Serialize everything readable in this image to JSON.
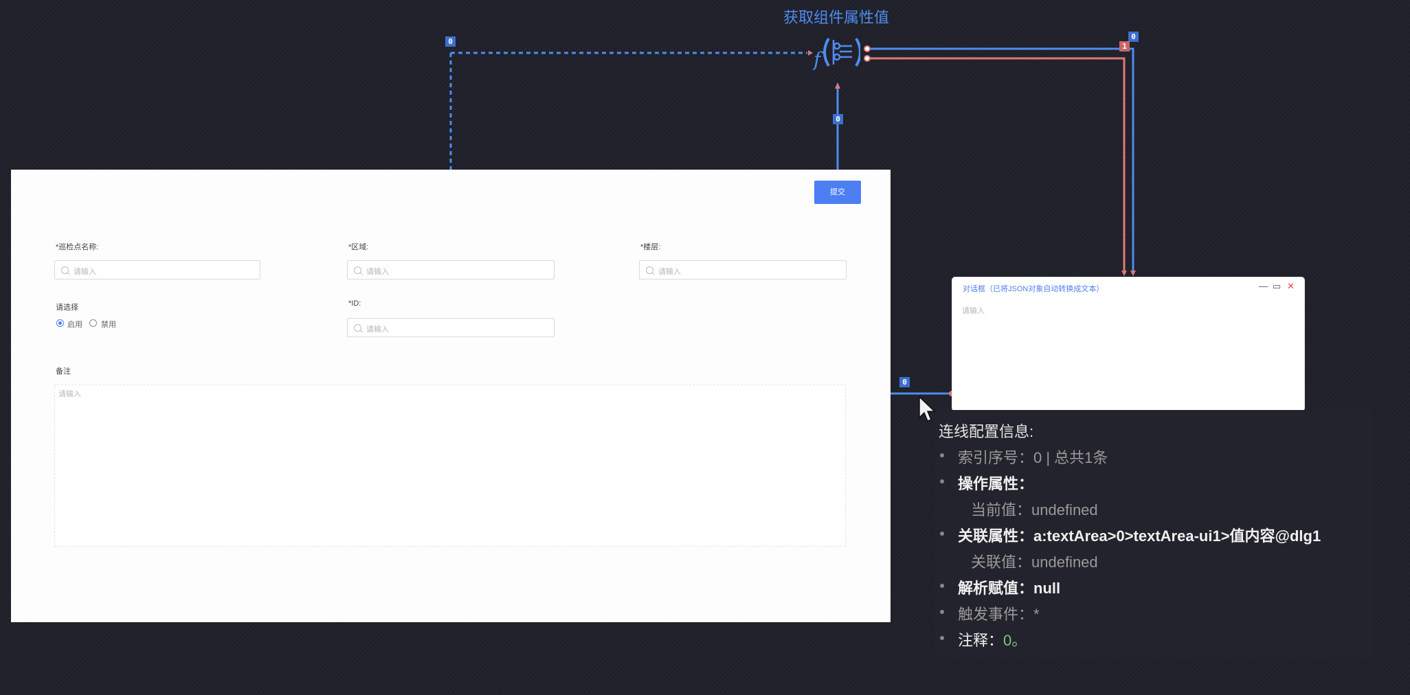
{
  "function_node": {
    "title": "获取组件属性值",
    "icon": "function-settings-icon"
  },
  "badges": {
    "top_left": "0",
    "submit_wire": "0",
    "right_blue": "0",
    "right_red": "1",
    "textarea_wire": "0"
  },
  "form": {
    "submit_label": "提交",
    "fields": {
      "name_label": "*巡检点名称:",
      "area_label": "*区域:",
      "floor_label": "*楼层:",
      "id_label": "*ID:",
      "remark_label": "备注"
    },
    "placeholder": "请输入",
    "radio_group": {
      "label": "请选择",
      "options": [
        "启用",
        "禁用"
      ],
      "selected": "启用"
    }
  },
  "dialog": {
    "title": "对话框（已将JSON对象自动转换成文本）",
    "placeholder": "请输入",
    "controls": {
      "minimize": "—",
      "maximize": "▭",
      "close": "✕"
    }
  },
  "tooltip": {
    "title": "连线配置信息:",
    "index": "索引序号：0 | 总共1条",
    "operate_attr_label": "操作属性：",
    "current_value": "当前值：undefined",
    "related_attr": "关联属性：a:textArea>0>textArea-ui1>值内容@dlg1",
    "related_value": "关联值：undefined",
    "parsed_value": "解析赋值：null",
    "trigger_event": "触发事件：*",
    "note_label": "注释：",
    "note_value": "0。"
  },
  "colors": {
    "wire_blue": "#4e8cf0",
    "wire_red": "#e07878",
    "button": "#4d7ff3",
    "background": "#1f2029"
  }
}
